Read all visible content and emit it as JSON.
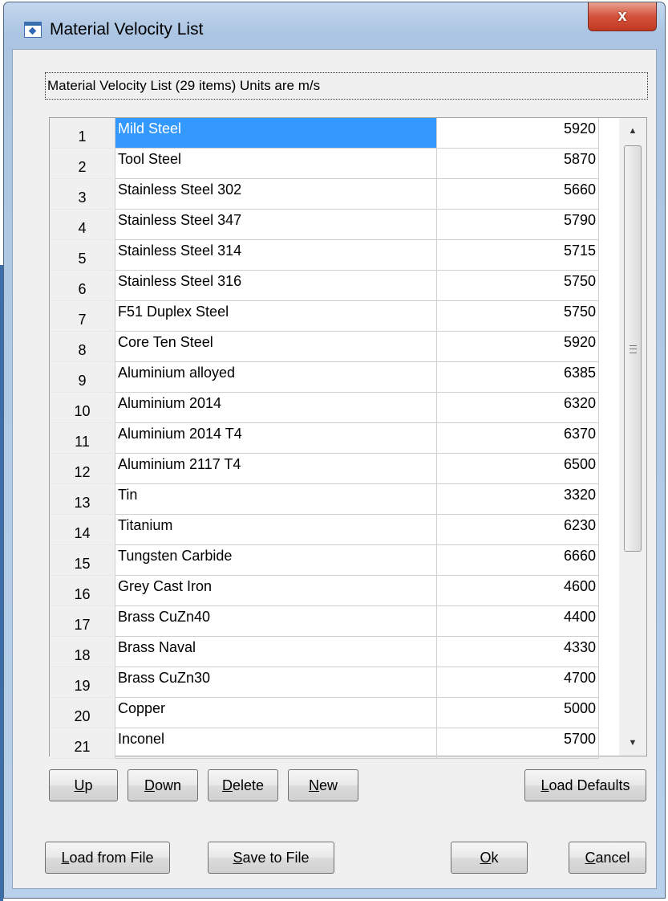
{
  "window": {
    "title": "Material Velocity List",
    "close_label": "x"
  },
  "group_label": "Material Velocity List (29 items) Units are m/s",
  "rows": [
    {
      "num": "1",
      "name": "Mild Steel",
      "velocity": "5920",
      "selected": true
    },
    {
      "num": "2",
      "name": "Tool Steel",
      "velocity": "5870"
    },
    {
      "num": "3",
      "name": "Stainless Steel 302",
      "velocity": "5660"
    },
    {
      "num": "4",
      "name": "Stainless Steel 347",
      "velocity": "5790"
    },
    {
      "num": "5",
      "name": "Stainless Steel 314",
      "velocity": "5715"
    },
    {
      "num": "6",
      "name": "Stainless Steel 316",
      "velocity": "5750"
    },
    {
      "num": "7",
      "name": "F51 Duplex Steel",
      "velocity": "5750"
    },
    {
      "num": "8",
      "name": "Core Ten Steel",
      "velocity": "5920"
    },
    {
      "num": "9",
      "name": "Aluminium alloyed",
      "velocity": "6385"
    },
    {
      "num": "10",
      "name": "Aluminium 2014",
      "velocity": "6320"
    },
    {
      "num": "11",
      "name": "Aluminium 2014 T4",
      "velocity": "6370"
    },
    {
      "num": "12",
      "name": "Aluminium 2117 T4",
      "velocity": "6500"
    },
    {
      "num": "13",
      "name": "Tin",
      "velocity": "3320"
    },
    {
      "num": "14",
      "name": "Titanium",
      "velocity": "6230"
    },
    {
      "num": "15",
      "name": "Tungsten Carbide",
      "velocity": "6660"
    },
    {
      "num": "16",
      "name": "Grey Cast Iron",
      "velocity": "4600"
    },
    {
      "num": "17",
      "name": "Brass CuZn40",
      "velocity": "4400"
    },
    {
      "num": "18",
      "name": "Brass Naval",
      "velocity": "4330"
    },
    {
      "num": "19",
      "name": "Brass CuZn30",
      "velocity": "4700"
    },
    {
      "num": "20",
      "name": "Copper",
      "velocity": "5000"
    },
    {
      "num": "21",
      "name": "Inconel",
      "velocity": "5700"
    }
  ],
  "buttons": {
    "up": {
      "mnemonic": "U",
      "rest": "p"
    },
    "down": {
      "mnemonic": "D",
      "rest": "own"
    },
    "delete": {
      "mnemonic": "D",
      "rest": "elete"
    },
    "new": {
      "mnemonic": "N",
      "rest": "ew"
    },
    "load_defaults": {
      "mnemonic": "L",
      "rest": "oad Defaults"
    },
    "load_from_file": {
      "mnemonic": "L",
      "rest": "oad from File"
    },
    "save_to_file": {
      "mnemonic": "S",
      "rest": "ave to File"
    },
    "ok": {
      "mnemonic": "O",
      "rest": "k"
    },
    "cancel": {
      "mnemonic": "C",
      "rest": "ancel"
    }
  },
  "scrollbar": {
    "up_icon": "arrow-up-icon",
    "down_icon": "arrow-down-icon",
    "grip_icon": "grip-icon"
  },
  "colors": {
    "selection": "#3399ff",
    "close_button": "#d3523b"
  }
}
